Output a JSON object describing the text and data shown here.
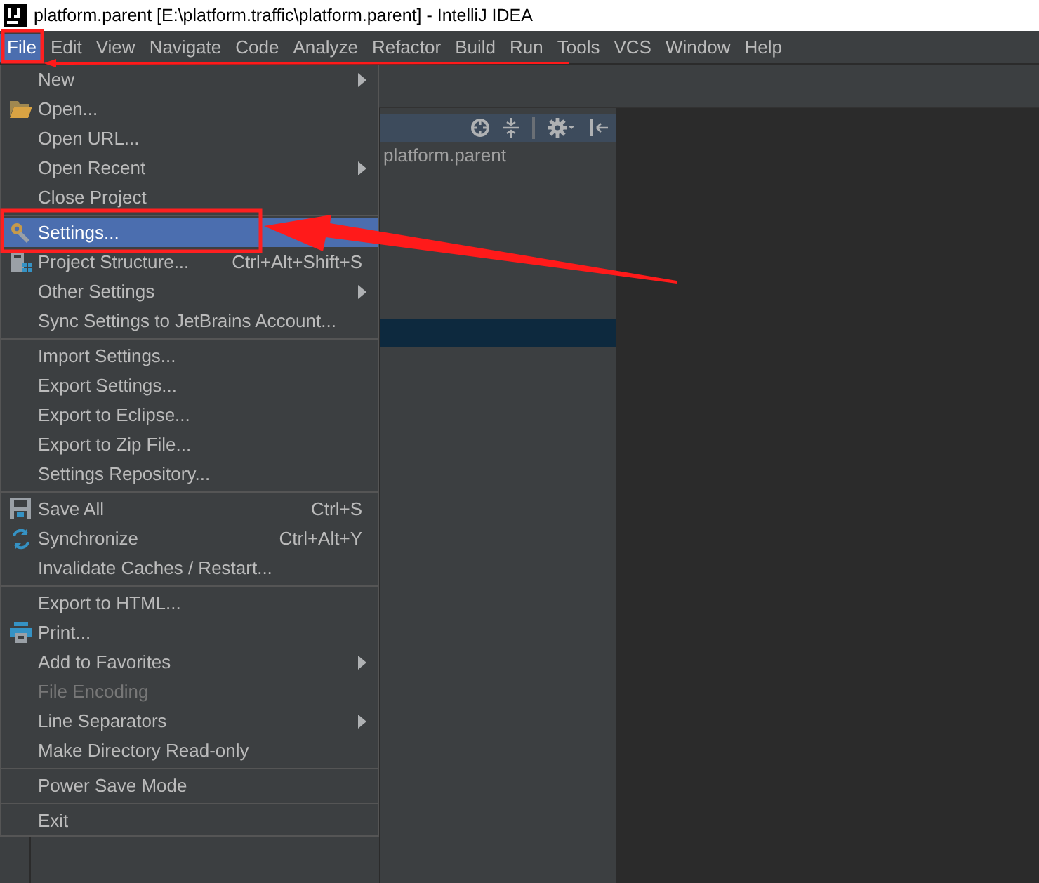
{
  "window": {
    "title": "platform.parent [E:\\platform.traffic\\platform.parent] - IntelliJ IDEA"
  },
  "menubar": [
    {
      "label": "File",
      "selected": true
    },
    {
      "label": "Edit",
      "selected": false
    },
    {
      "label": "View",
      "selected": false
    },
    {
      "label": "Navigate",
      "selected": false
    },
    {
      "label": "Code",
      "selected": false
    },
    {
      "label": "Analyze",
      "selected": false
    },
    {
      "label": "Refactor",
      "selected": false
    },
    {
      "label": "Build",
      "selected": false
    },
    {
      "label": "Run",
      "selected": false
    },
    {
      "label": "Tools",
      "selected": false
    },
    {
      "label": "VCS",
      "selected": false
    },
    {
      "label": "Window",
      "selected": false
    },
    {
      "label": "Help",
      "selected": false
    }
  ],
  "file_menu": [
    {
      "kind": "item",
      "label": "New",
      "submenu": true,
      "disabled": false,
      "selected": false
    },
    {
      "kind": "item",
      "label": "Open...",
      "disabled": false,
      "selected": false
    },
    {
      "kind": "item",
      "label": "Open URL...",
      "disabled": false,
      "selected": false
    },
    {
      "kind": "item",
      "label": "Open Recent",
      "submenu": true,
      "disabled": false,
      "selected": false
    },
    {
      "kind": "item",
      "label": "Close Project",
      "disabled": false,
      "selected": false
    },
    {
      "kind": "separator"
    },
    {
      "kind": "item",
      "label": "Settings...",
      "disabled": false,
      "selected": true
    },
    {
      "kind": "item",
      "label": "Project Structure...",
      "shortcut": "Ctrl+Alt+Shift+S",
      "disabled": false,
      "selected": false
    },
    {
      "kind": "item",
      "label": "Other Settings",
      "submenu": true,
      "disabled": false,
      "selected": false
    },
    {
      "kind": "item",
      "label": "Sync Settings to JetBrains Account...",
      "disabled": false,
      "selected": false
    },
    {
      "kind": "separator"
    },
    {
      "kind": "item",
      "label": "Import Settings...",
      "disabled": false,
      "selected": false
    },
    {
      "kind": "item",
      "label": "Export Settings...",
      "disabled": false,
      "selected": false
    },
    {
      "kind": "item",
      "label": "Export to Eclipse...",
      "disabled": false,
      "selected": false
    },
    {
      "kind": "item",
      "label": "Export to Zip File...",
      "disabled": false,
      "selected": false
    },
    {
      "kind": "item",
      "label": "Settings Repository...",
      "disabled": false,
      "selected": false
    },
    {
      "kind": "separator"
    },
    {
      "kind": "item",
      "label": "Save All",
      "shortcut": "Ctrl+S",
      "disabled": false,
      "selected": false
    },
    {
      "kind": "item",
      "label": "Synchronize",
      "shortcut": "Ctrl+Alt+Y",
      "disabled": false,
      "selected": false
    },
    {
      "kind": "item",
      "label": "Invalidate Caches / Restart...",
      "disabled": false,
      "selected": false
    },
    {
      "kind": "separator"
    },
    {
      "kind": "item",
      "label": "Export to HTML...",
      "disabled": false,
      "selected": false
    },
    {
      "kind": "item",
      "label": "Print...",
      "disabled": false,
      "selected": false
    },
    {
      "kind": "item",
      "label": "Add to Favorites",
      "submenu": true,
      "disabled": false,
      "selected": false
    },
    {
      "kind": "item",
      "label": "File Encoding",
      "disabled": true,
      "selected": false
    },
    {
      "kind": "item",
      "label": "Line Separators",
      "submenu": true,
      "disabled": false,
      "selected": false
    },
    {
      "kind": "item",
      "label": "Make Directory Read-only",
      "disabled": false,
      "selected": false
    },
    {
      "kind": "separator"
    },
    {
      "kind": "item",
      "label": "Power Save Mode",
      "disabled": false,
      "selected": false
    },
    {
      "kind": "separator"
    },
    {
      "kind": "item",
      "label": "Exit",
      "disabled": false,
      "selected": false
    }
  ],
  "project_panel": {
    "tree": [
      {
        "label": "platform.parent",
        "selected": false
      },
      {
        "selected": true
      }
    ]
  }
}
